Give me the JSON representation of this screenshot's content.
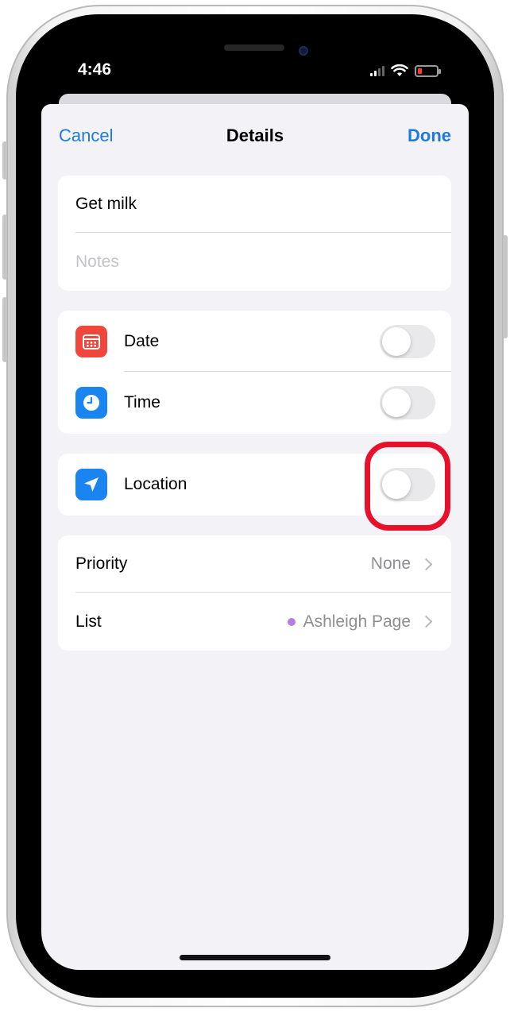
{
  "status_bar": {
    "time": "4:46"
  },
  "nav": {
    "cancel_label": "Cancel",
    "title": "Details",
    "done_label": "Done"
  },
  "task": {
    "title_value": "Get milk",
    "notes_placeholder": "Notes"
  },
  "schedule": {
    "date": {
      "label": "Date",
      "icon": "calendar-icon",
      "toggle_on": false
    },
    "time": {
      "label": "Time",
      "icon": "clock-icon",
      "toggle_on": false
    }
  },
  "location": {
    "label": "Location",
    "icon": "location-arrow-icon",
    "toggle_on": false
  },
  "options": {
    "priority": {
      "label": "Priority",
      "value": "None"
    },
    "list": {
      "label": "List",
      "value": "Ashleigh Page",
      "dot_color": "#b37fe0"
    }
  },
  "colors": {
    "accent": "#1f7ae0",
    "highlight": "#e8102a",
    "date_icon": "#f0463c",
    "time_icon": "#1a84f0"
  }
}
